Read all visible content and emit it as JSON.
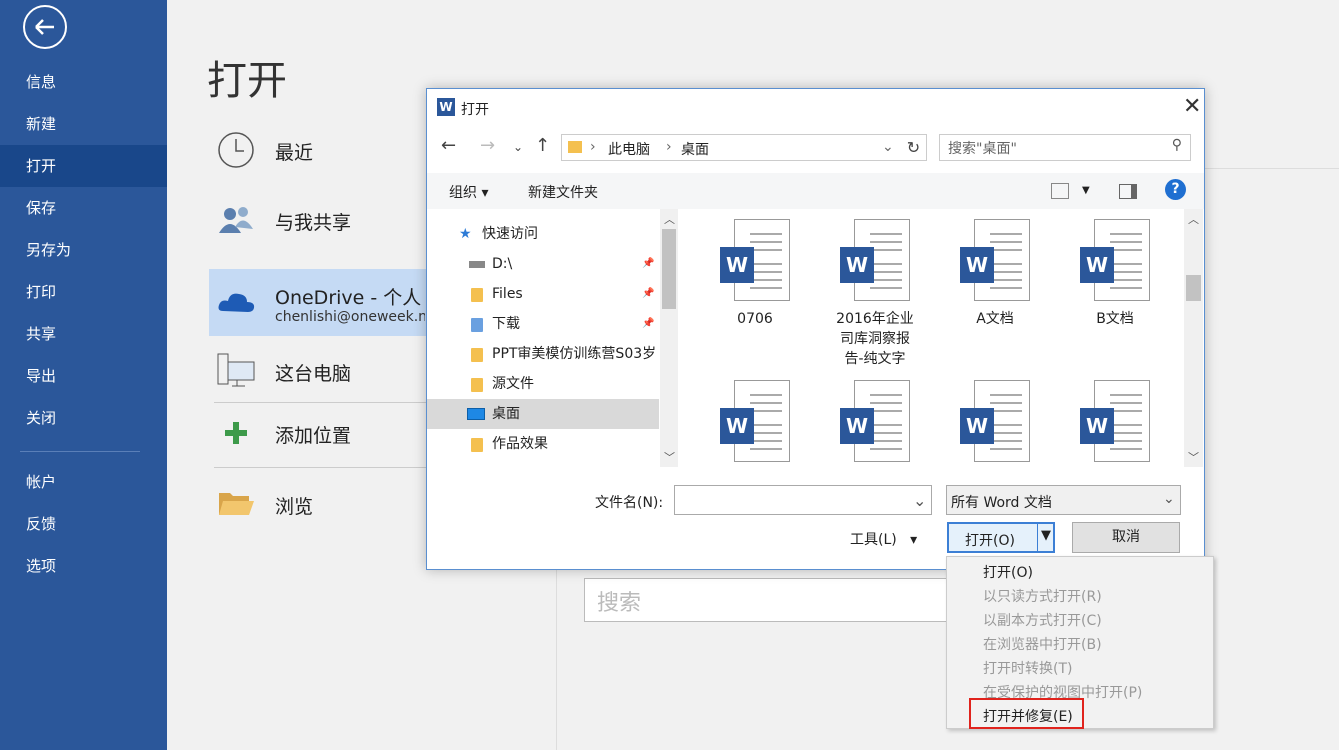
{
  "nav": {
    "items": [
      "信息",
      "新建",
      "打开",
      "保存",
      "另存为",
      "打印",
      "共享",
      "导出",
      "关闭"
    ],
    "items2": [
      "帐户",
      "反馈",
      "选项"
    ]
  },
  "page": {
    "title": "打开"
  },
  "places": {
    "recent": "最近",
    "shared": "与我共享",
    "onedrive": "OneDrive - 个人",
    "onedrive_email": "chenlishi@oneweek.n",
    "this_pc": "这台电脑",
    "add_place": "添加位置",
    "browse": "浏览"
  },
  "bg_search": {
    "placeholder": "搜索"
  },
  "dialog": {
    "title": "打开",
    "address": [
      "此电脑",
      "桌面"
    ],
    "search_placeholder": "搜索\"桌面\"",
    "toolbar": {
      "organize": "组织",
      "new_folder": "新建文件夹"
    },
    "tree": {
      "quick_access": "快速访问",
      "items": [
        {
          "label": "D:\\",
          "pinned": true
        },
        {
          "label": "Files",
          "pinned": true
        },
        {
          "label": "下载",
          "pinned": true
        },
        {
          "label": "PPT审美模仿训练营S03岁",
          "pinned": false
        },
        {
          "label": "源文件",
          "pinned": false
        },
        {
          "label": "桌面",
          "pinned": false,
          "selected": true
        },
        {
          "label": "作品效果",
          "pinned": false
        }
      ]
    },
    "files": [
      {
        "name": "0706"
      },
      {
        "name": "2016年企业\n司库洞察报\n告-纯文字"
      },
      {
        "name": "A文档"
      },
      {
        "name": "B文档"
      },
      {
        "name": ""
      },
      {
        "name": ""
      },
      {
        "name": ""
      },
      {
        "name": ""
      }
    ],
    "filename_label": "文件名(N):",
    "filename_value": "",
    "filetype": "所有 Word 文档",
    "tools": "工具(L)",
    "open": "打开(O)",
    "cancel": "取消"
  },
  "menu": {
    "items": [
      {
        "label": "打开(O)",
        "enabled": true
      },
      {
        "label": "以只读方式打开(R)",
        "enabled": false
      },
      {
        "label": "以副本方式打开(C)",
        "enabled": false
      },
      {
        "label": "在浏览器中打开(B)",
        "enabled": false
      },
      {
        "label": "打开时转换(T)",
        "enabled": false
      },
      {
        "label": "在受保护的视图中打开(P)",
        "enabled": false
      },
      {
        "label": "打开并修复(E)",
        "enabled": true,
        "highlighted": true
      }
    ]
  },
  "colors": {
    "nav_bg": "#2b579a",
    "nav_active": "#19478a",
    "highlight": "#e0231d",
    "word_blue": "#2b579a"
  }
}
